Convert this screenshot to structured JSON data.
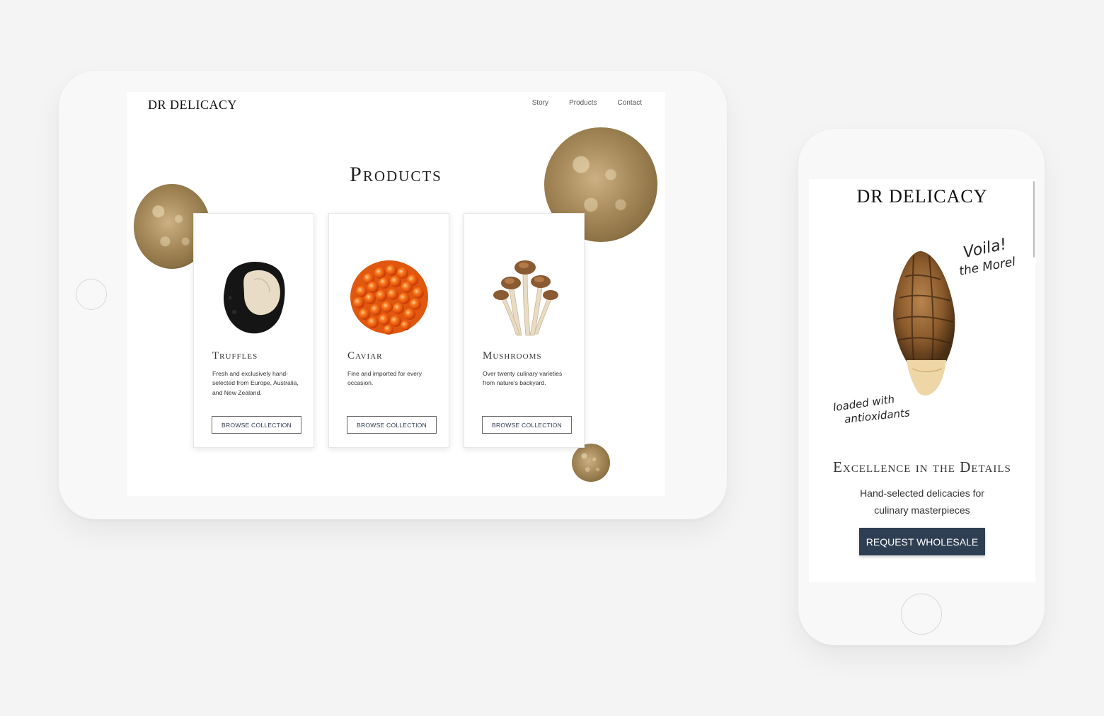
{
  "tablet": {
    "logo": "DR DELICACY",
    "nav": [
      "Story",
      "Products",
      "Contact"
    ],
    "title": "Products",
    "cards": [
      {
        "title": "Truffles",
        "description": "Fresh and exclusively hand-selected from Europe, Australia, and New Zealand.",
        "button": "BROWSE COLLECTION",
        "image": "truffle-image"
      },
      {
        "title": "Caviar",
        "description": "Fine and imported for every occasion.",
        "button": "BROWSE COLLECTION",
        "image": "caviar-image"
      },
      {
        "title": "Mushrooms",
        "description": "Over twenty culinary varieties from nature's backyard.",
        "button": "BROWSE COLLECTION",
        "image": "mushrooms-image"
      }
    ]
  },
  "phone": {
    "logo": "DR DELICACY",
    "note_top_line1": "Voila!",
    "note_top_line2": "the Morel",
    "note_bottom_line1": "loaded with",
    "note_bottom_line2": "antioxidants",
    "headline": "Excellence in the Details",
    "subtitle": "Hand-selected delicacies for culinary masterpieces",
    "cta": "REQUEST WHOLESALE"
  },
  "colors": {
    "background": "#f4f4f4",
    "device": "#f8f8f8",
    "cta_bg": "#2f3f53",
    "button_text": "#2c3a4e"
  }
}
